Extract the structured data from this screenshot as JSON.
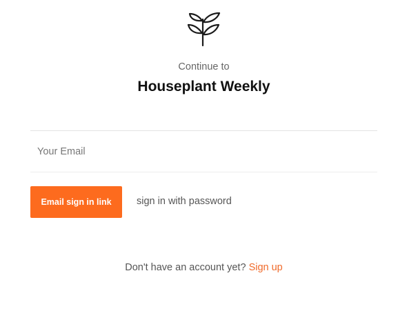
{
  "header": {
    "logo_icon": "sprout-icon",
    "subtitle": "Continue to",
    "title": "Houseplant Weekly"
  },
  "form": {
    "email_placeholder": "Your Email",
    "email_value": "",
    "primary_button_label": "Email sign in link",
    "password_link_label": "sign in with password"
  },
  "footer": {
    "prompt": "Don't have an account yet?",
    "signup_label": "Sign up"
  },
  "colors": {
    "accent": "#fd6b1e",
    "link": "#f06a2a"
  }
}
